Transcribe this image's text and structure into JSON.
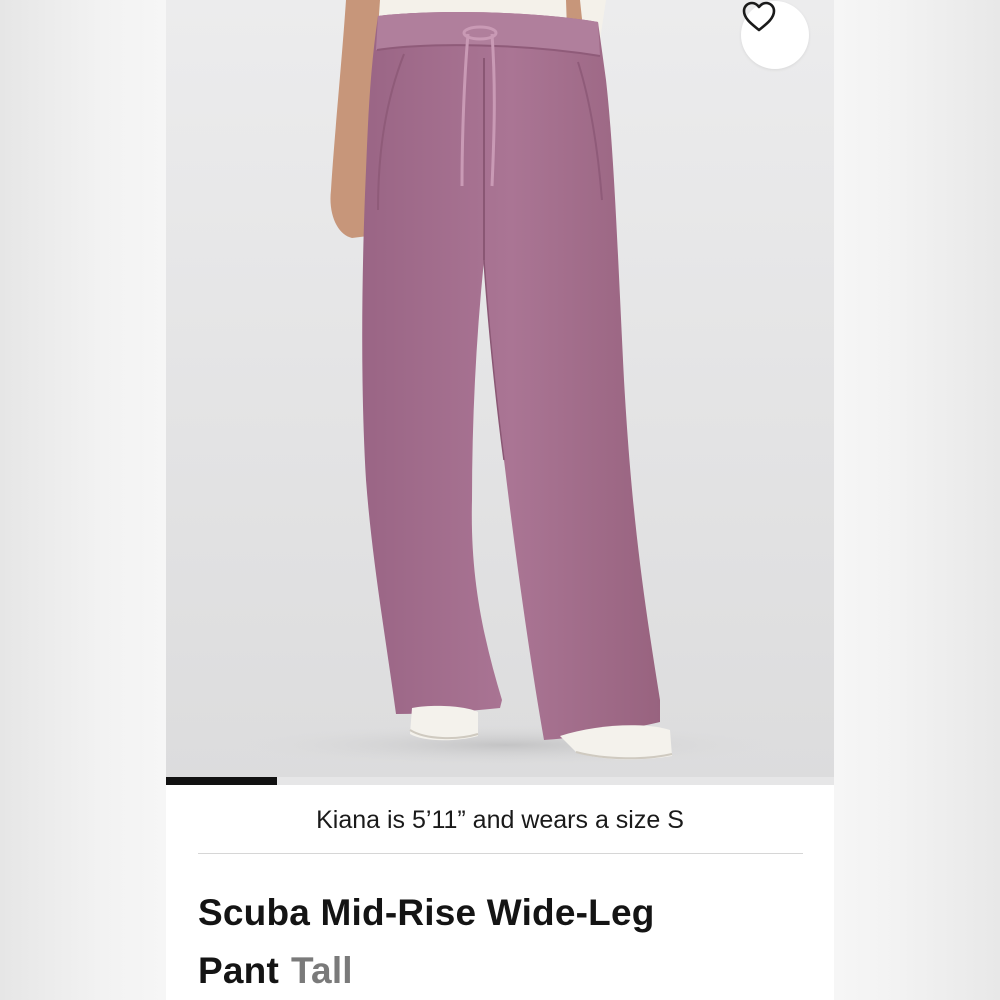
{
  "product": {
    "caption": "Kiana is 5’11” and wears a size S",
    "title": "Scuba Mid-Rise Wide-Leg Pant",
    "variant": "Tall",
    "image_description": "Model wearing purple wide-leg pants with drawstring waist and white sneakers",
    "favorite_icon": "heart-icon"
  },
  "carousel": {
    "current_slide_fraction": 0.166
  },
  "colors": {
    "pant": "#a5708f",
    "background": "#e6e6e7",
    "indicator": "#111111",
    "variant_text": "#7a7a7a"
  }
}
